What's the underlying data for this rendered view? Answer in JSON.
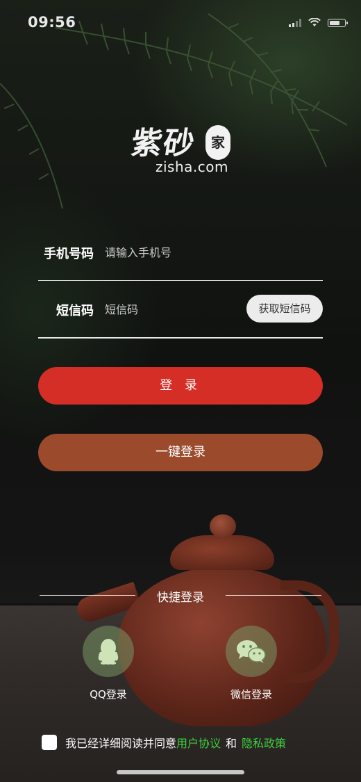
{
  "status_bar": {
    "time": "09:56"
  },
  "logo": {
    "script": "紫砂",
    "seal": "家",
    "domain": "zisha.com"
  },
  "form": {
    "phone_label": "手机号码",
    "phone_placeholder": "请输入手机号",
    "sms_label": "短信码",
    "sms_placeholder": "短信码",
    "get_code_label": "获取短信码"
  },
  "buttons": {
    "login": "登 录",
    "one_click": "一键登录"
  },
  "quick_login": {
    "title": "快捷登录",
    "items": [
      {
        "label": "QQ登录",
        "icon": "qq-icon"
      },
      {
        "label": "微信登录",
        "icon": "wechat-icon"
      }
    ]
  },
  "agreement": {
    "prefix": "我已经详细阅读并同意",
    "user_agreement": "用户协议",
    "and": "和",
    "privacy_policy": "隐私政策"
  },
  "colors": {
    "login_button": "#d42e26",
    "one_click_button": "#9b4a2c",
    "link": "#3ecf3e",
    "social_circle": "#6e8a5c"
  }
}
